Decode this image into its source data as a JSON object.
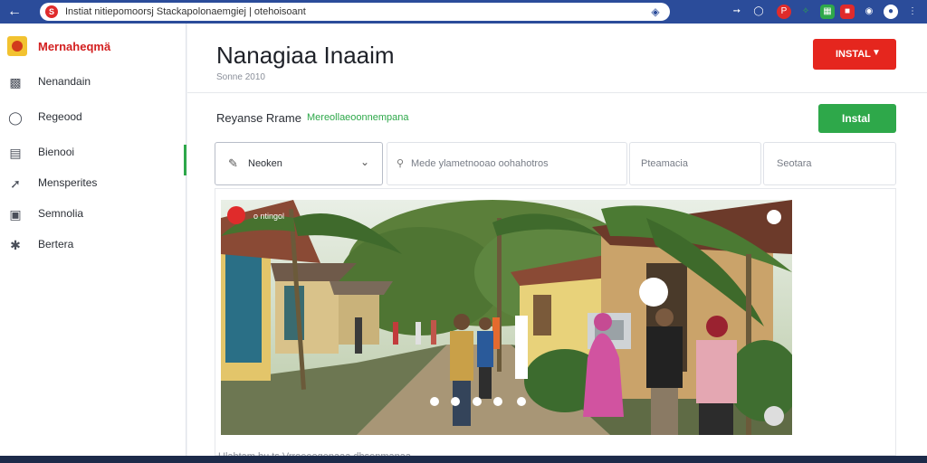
{
  "browser": {
    "url": "Instiat nitiepomoorsj Stackapolonaemgiej | otehoisoant",
    "favicon_letter": "S"
  },
  "sidebar": {
    "brand": "Mernaheqmä",
    "items": [
      {
        "label": "Nenandain",
        "icon": "gallery-icon"
      },
      {
        "label": "Regeood",
        "icon": "clock-icon"
      },
      {
        "label": "Bienooi",
        "icon": "chart-icon"
      },
      {
        "label": "Mensperites",
        "icon": "pin-icon"
      },
      {
        "label": "Semnolia",
        "icon": "photo-icon"
      },
      {
        "label": "Bertera",
        "icon": "star-icon"
      }
    ]
  },
  "header": {
    "title": "Nanagiaa Inaaim",
    "subtitle": "Sonne 2010",
    "install_dropdown_label": "INSTAL"
  },
  "section": {
    "title": "Reyanse Rrame",
    "link": "Mereollaeoonnempana",
    "install_button_label": "Instal"
  },
  "filters": {
    "select_value": "Neoken",
    "location_placeholder": "Mede ylametnooao oohahotros",
    "field3_placeholder": "Pteamacia",
    "field4_placeholder": "Seotara"
  },
  "photo": {
    "overlay_label": "o ntingol"
  },
  "caption": "Ulahtam bu ts Vrroeeogenaaa dhsenmanaa...",
  "colors": {
    "topbar": "#2b4c9a",
    "red_button": "#e5261e",
    "green_button": "#2ea84a",
    "brand": "#d32020"
  }
}
